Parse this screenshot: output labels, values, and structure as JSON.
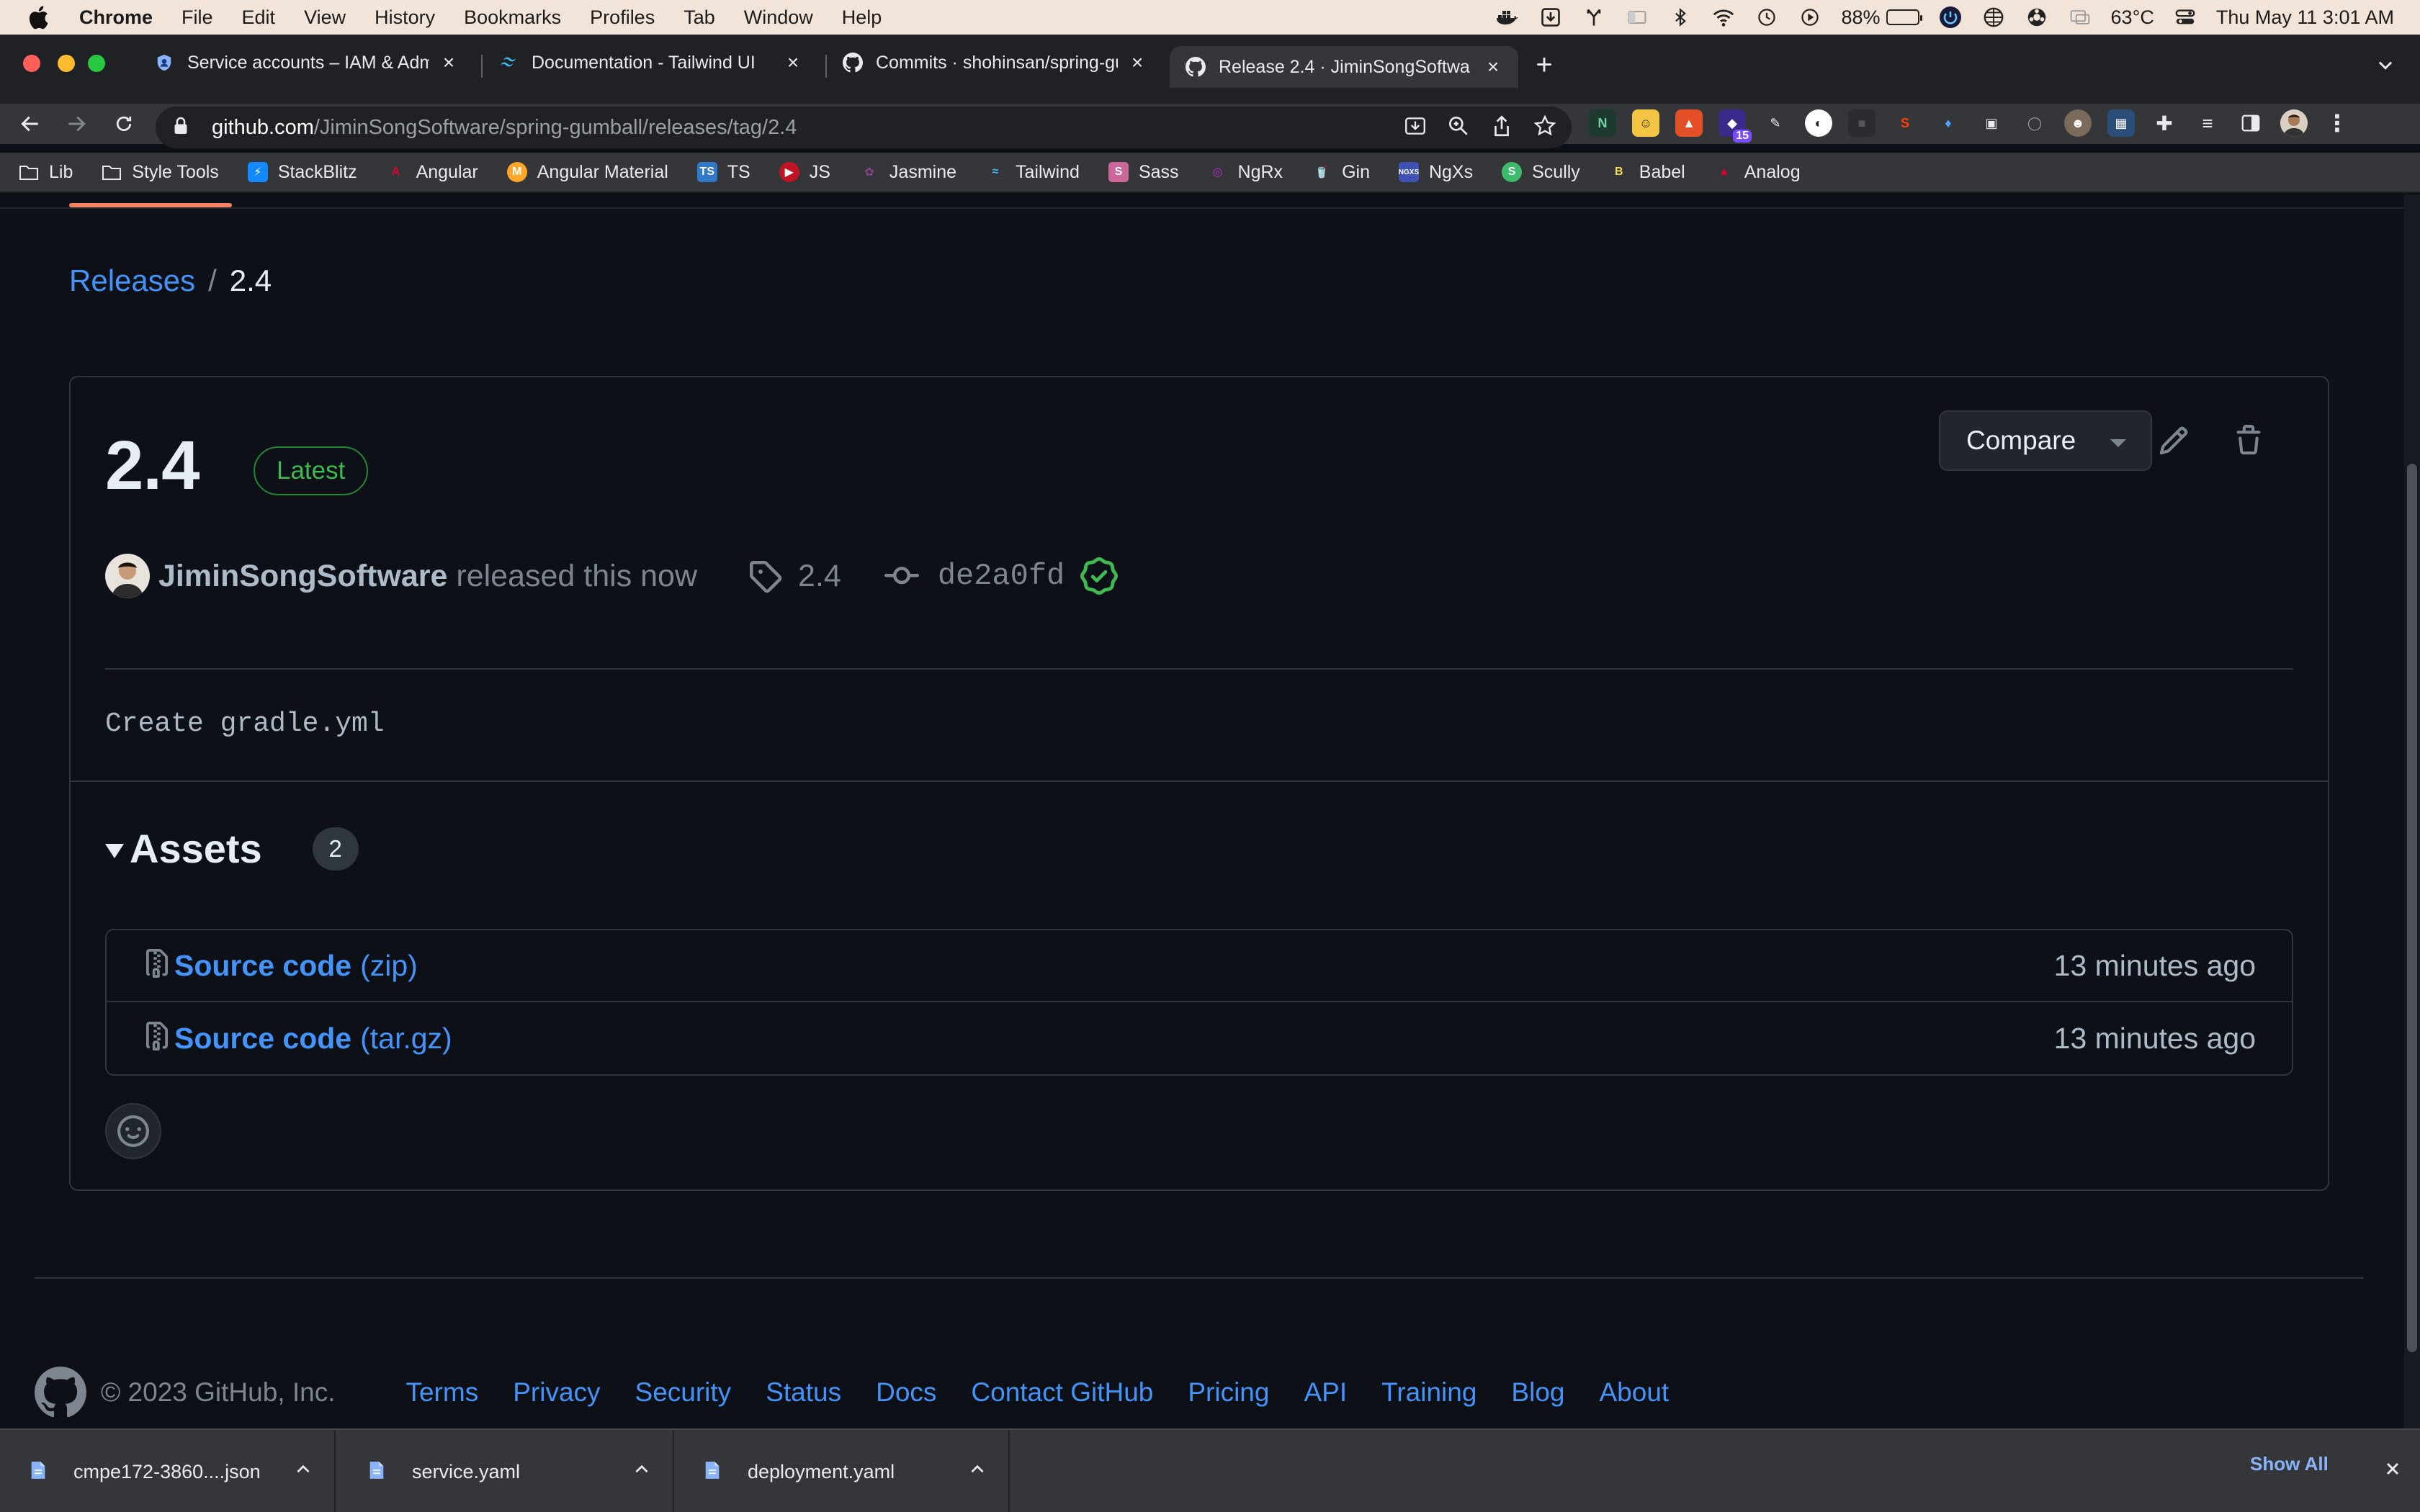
{
  "menubar": {
    "items": [
      "Chrome",
      "File",
      "Edit",
      "View",
      "History",
      "Bookmarks",
      "Profiles",
      "Tab",
      "Window",
      "Help"
    ],
    "battery": "88%",
    "temperature": "63°C",
    "datetime": "Thu May 11  3:01 AM"
  },
  "tabs": [
    {
      "label": "Service accounts – IAM & Adm",
      "icon": "shield-icon"
    },
    {
      "label": "Documentation - Tailwind UI",
      "icon": "tailwind-icon"
    },
    {
      "label": "Commits · shohinsan/spring-gu",
      "icon": "github-icon"
    },
    {
      "label": "Release 2.4 · JiminSongSoftwa",
      "icon": "github-icon"
    }
  ],
  "address": {
    "host": "github.com",
    "path": "/JiminSongSoftware/spring-gumball/releases/tag/2.4"
  },
  "extensions": {
    "badge": "15"
  },
  "bookmarks": [
    "Lib",
    "Style Tools",
    "StackBlitz",
    "Angular",
    "Angular Material",
    "TS",
    "JS",
    "Jasmine",
    "Tailwind",
    "Sass",
    "NgRx",
    "Gin",
    "NgXs",
    "Scully",
    "Babel",
    "Analog"
  ],
  "breadcrumb": {
    "parent": "Releases",
    "separator": "/",
    "current": "2.4"
  },
  "release": {
    "title": "2.4",
    "badge": "Latest",
    "compare_label": "Compare",
    "author": "JiminSongSoftware",
    "released_text": "released this now",
    "tag": "2.4",
    "commit": "de2a0fd",
    "body": "Create gradle.yml"
  },
  "assets": {
    "title": "Assets",
    "count": "2",
    "items": [
      {
        "name": "Source code",
        "ext": "(zip)",
        "time": "13 minutes ago"
      },
      {
        "name": "Source code",
        "ext": "(tar.gz)",
        "time": "13 minutes ago"
      }
    ]
  },
  "footer": {
    "copyright": "© 2023 GitHub, Inc.",
    "links": [
      "Terms",
      "Privacy",
      "Security",
      "Status",
      "Docs",
      "Contact GitHub",
      "Pricing",
      "API",
      "Training",
      "Blog",
      "About"
    ]
  },
  "downloads": {
    "items": [
      "cmpe172-3860....json",
      "service.yaml",
      "deployment.yaml"
    ],
    "show_all": "Show All"
  },
  "colors": {
    "accent_link": "#4493f8",
    "latest_green": "#3fb950",
    "page_bg": "#0d1117",
    "border": "#30363d"
  }
}
